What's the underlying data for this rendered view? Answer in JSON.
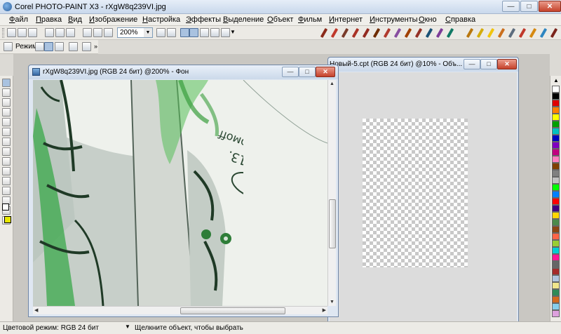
{
  "app": {
    "title": "Corel PHOTO-PAINT X3 - rXgW8q239VI.jpg"
  },
  "menu": [
    "Файл",
    "Правка",
    "Вид",
    "Изображение",
    "Настройка",
    "Эффекты",
    "Выделение",
    "Объект",
    "Фильм",
    "Интернет",
    "Инструменты",
    "Окно",
    "Справка"
  ],
  "toolbar": {
    "zoom_value": "200%"
  },
  "propbar": {
    "mode_label": "Режим"
  },
  "documents": [
    {
      "title": "rXgW8q239VI.jpg (RGB 24 бит) @200% - Фон"
    },
    {
      "title": "Новый-5.cpt (RGB 24 бит) @10% - Объ..."
    }
  ],
  "status": {
    "color_mode": "Цветовой режим: RGB 24 бит",
    "hint": "Щелкните объект, чтобы выбрать"
  },
  "palette_colors": [
    "#ffffff",
    "#000000",
    "#e00000",
    "#ff8000",
    "#ffff00",
    "#00a000",
    "#00c0c0",
    "#0000c0",
    "#8000c0",
    "#c00080",
    "#ff80c0",
    "#804000",
    "#808080",
    "#c0c0c0",
    "#00ff00",
    "#0080ff",
    "#ff0000",
    "#400080",
    "#ffd700",
    "#4b8a4b",
    "#8b4513",
    "#ff6347",
    "#9acd32",
    "#00ced1",
    "#ff1493",
    "#666666",
    "#a52a2a",
    "#b0c4de",
    "#f0e68c",
    "#2e8b57",
    "#d2691e",
    "#87ceeb",
    "#dda0dd"
  ]
}
